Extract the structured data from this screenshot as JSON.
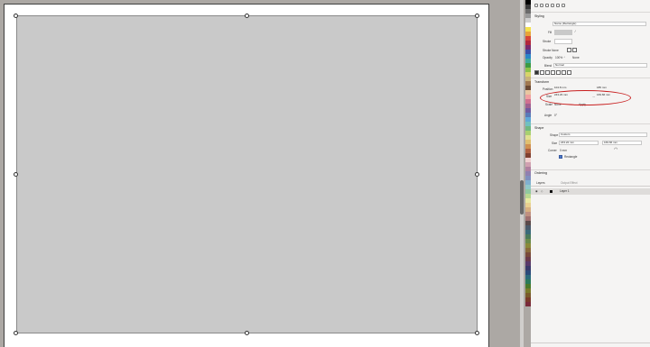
{
  "palette_colors": [
    "#000000",
    "#3a3a3a",
    "#6b6b6b",
    "#9a9a9a",
    "#cfcfcf",
    "#ffffff",
    "#f4e04d",
    "#e8a33a",
    "#d6453a",
    "#b1283c",
    "#7a2a6e",
    "#3a4fa8",
    "#2a86c8",
    "#3fa89a",
    "#3d9a44",
    "#8cc24a",
    "#d8d46a",
    "#c9b27a",
    "#a07850",
    "#6c4a34",
    "#e8c6a0",
    "#f0a0a0",
    "#d07090",
    "#a06090",
    "#705aa0",
    "#5a7ab8",
    "#60a8d8",
    "#70c0c0",
    "#70b880",
    "#a8d070",
    "#e0e090",
    "#e0c070",
    "#d09050",
    "#b06040",
    "#804030",
    "#f0d0d0",
    "#d0a0b0",
    "#b080a0",
    "#9080b0",
    "#8090c0",
    "#80b0d0",
    "#90c8c8",
    "#90c8a0",
    "#b8d890",
    "#e8e8a0",
    "#e8d090",
    "#d8b080",
    "#c09080",
    "#a07070",
    "#5a4a4a",
    "#4a5a6a",
    "#3a6a7a",
    "#4a7a5a",
    "#6a8a4a",
    "#8a8a3a",
    "#8a6a3a",
    "#7a4a3a",
    "#6a3a4a",
    "#5a3a6a",
    "#3a3a6a",
    "#2a4a7a",
    "#2a6a7a",
    "#2a7a5a",
    "#4a7a2a",
    "#7a7a2a",
    "#7a5a2a",
    "#7a3a2a",
    "#7a2a3a"
  ],
  "panel": {
    "styling": {
      "title": "Styling",
      "name": "Name (Rectangle)",
      "fill_label": "Fill",
      "stroke_label": "Stroke",
      "stroke_none_label": "Stroke None",
      "opacity_label": "Opacity",
      "opacity_value": "100% ⌃",
      "opacity_blend_value": "None",
      "blend_label": "Blend",
      "blend_value": "Normal"
    },
    "transform": {
      "title": "Transform",
      "position_label": "Position",
      "position_x": "104.8 mm",
      "position_y": "185 mm",
      "size_label": "Size",
      "size_w": "243.23 mm",
      "size_h": "169.66 mm",
      "scale_label": "Scale",
      "scale_value": "None",
      "scale_extra": "Apply",
      "angle_label": "Angle",
      "angle_value": "0°"
    },
    "shape": {
      "title": "Shape",
      "shape_label": "Shape",
      "shape_value": "Custom",
      "size_label": "Size",
      "size_w": "243.22 mm",
      "size_h": "169.66 mm",
      "corner_label": "Corner",
      "corner_value": "0 mm",
      "checkbox_label": "Rectangle"
    },
    "ordering": {
      "title": "Ordering"
    },
    "layers": {
      "tab_layers": "Layers",
      "tab_effects": "Output Effect",
      "layer_name": "Layer 1"
    }
  }
}
